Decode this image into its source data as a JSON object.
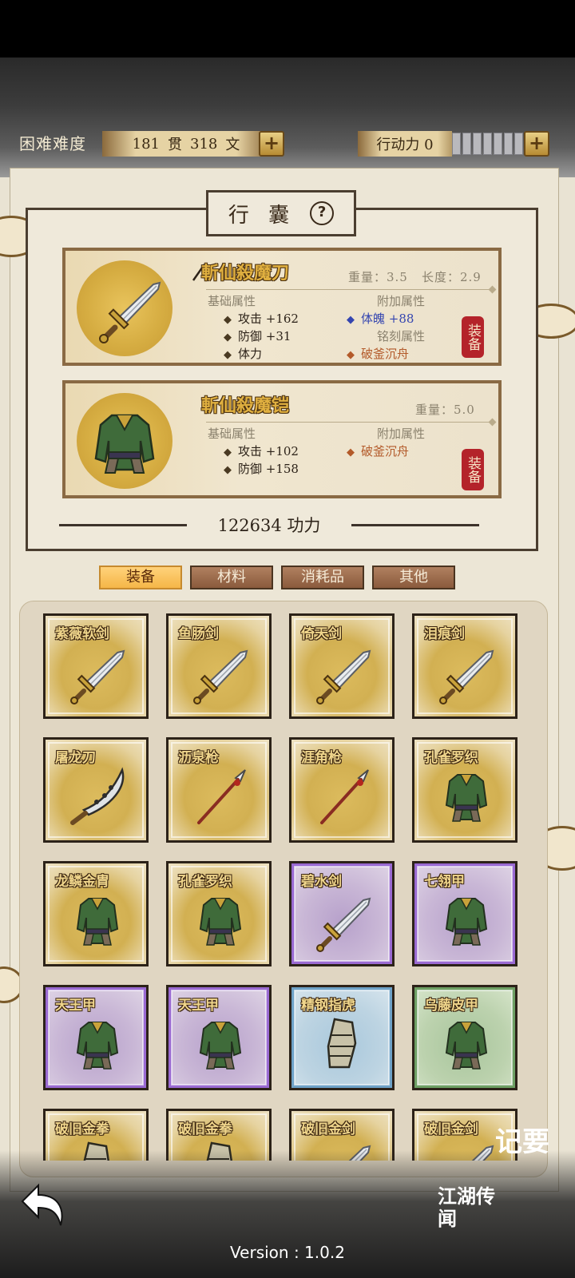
{
  "header": {
    "difficulty": "困难难度",
    "money": {
      "guan_value": "181",
      "guan_unit": "贯",
      "wen_value": "318",
      "wen_unit": "文"
    },
    "action_power": "行动力 0",
    "stamina_segments": 8
  },
  "bag": {
    "title": "行 囊",
    "equipped": [
      {
        "name": "斬仙殺魔刀",
        "icon": "sword-icon",
        "weight": "重量：3.5",
        "length": "长度：2.9",
        "base_label": "基础属性",
        "base_stats": [
          "攻击 +162",
          "防御 +31",
          "体力"
        ],
        "add_label": "附加属性",
        "add_stats": [
          "体魄 +88"
        ],
        "engrave_label": "铭刻属性",
        "engrave_stats": [
          "破釜沉舟"
        ],
        "action": "装备"
      },
      {
        "name": "斬仙殺魔铠",
        "icon": "armor-icon",
        "weight": "重量：5.0",
        "base_label": "基础属性",
        "base_stats": [
          "攻击 +102",
          "防御 +158"
        ],
        "add_label": "附加属性",
        "add_stats": [
          "破釜沉舟"
        ],
        "action": "装备"
      }
    ],
    "power": "122634 功力"
  },
  "tabs": [
    {
      "label": "装备",
      "active": true
    },
    {
      "label": "材料",
      "active": false
    },
    {
      "label": "消耗品",
      "active": false
    },
    {
      "label": "其他",
      "active": false
    }
  ],
  "items": [
    {
      "name": "紫薇软剑",
      "icon": "sword-icon",
      "rarity": "gold"
    },
    {
      "name": "鱼肠剑",
      "icon": "sword-icon",
      "rarity": "gold"
    },
    {
      "name": "倚天剑",
      "icon": "sword-icon",
      "rarity": "gold"
    },
    {
      "name": "泪痕剑",
      "icon": "sword-icon",
      "rarity": "gold"
    },
    {
      "name": "屠龙刀",
      "icon": "dragon-blade-icon",
      "rarity": "gold"
    },
    {
      "name": "沥泉枪",
      "icon": "spear-icon",
      "rarity": "gold"
    },
    {
      "name": "涯角枪",
      "icon": "spear-icon",
      "rarity": "gold"
    },
    {
      "name": "孔雀罗织",
      "icon": "armor-icon",
      "rarity": "gold"
    },
    {
      "name": "龙鳞金胄",
      "icon": "armor-icon",
      "rarity": "gold"
    },
    {
      "name": "孔雀罗织",
      "icon": "armor-icon",
      "rarity": "gold"
    },
    {
      "name": "碧水剑",
      "icon": "sword-icon",
      "rarity": "purple"
    },
    {
      "name": "七翎甲",
      "icon": "armor-icon",
      "rarity": "purple"
    },
    {
      "name": "天王甲",
      "icon": "armor-icon",
      "rarity": "purple"
    },
    {
      "name": "天王甲",
      "icon": "armor-icon",
      "rarity": "purple"
    },
    {
      "name": "精钢指虎",
      "icon": "gauntlet-icon",
      "rarity": "blue"
    },
    {
      "name": "乌藤皮甲",
      "icon": "armor-icon",
      "rarity": "green"
    },
    {
      "name": "破旧金拳",
      "icon": "gauntlet-icon",
      "rarity": "gold"
    },
    {
      "name": "破旧金拳",
      "icon": "gauntlet-icon",
      "rarity": "gold"
    },
    {
      "name": "破旧金剑",
      "icon": "sword-icon",
      "rarity": "gold"
    },
    {
      "name": "破旧金剑",
      "icon": "sword-icon",
      "rarity": "gold"
    }
  ],
  "side_buttons": {
    "notes": "记要",
    "rumors": "江湖传闻"
  },
  "version": "Version : 1.0.2"
}
